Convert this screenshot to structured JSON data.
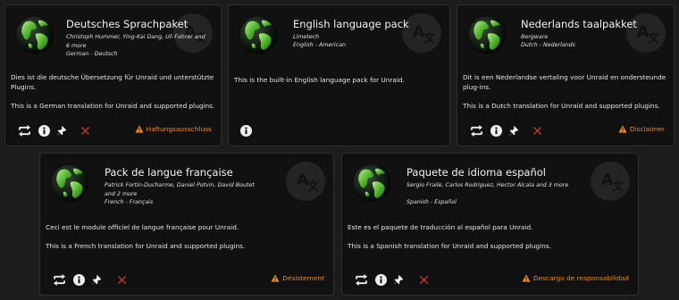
{
  "colors": {
    "accent": "#f08a1c",
    "close": "#c0392b",
    "card_bg": "#111111"
  },
  "icons": {
    "globe": "globe-icon",
    "watermark": "translate-icon",
    "sync": "sync-icon",
    "info": "info-icon",
    "pin": "pin-icon",
    "remove": "close-icon",
    "warning": "warning-icon"
  },
  "plugins": [
    {
      "name": "Deutsches Sprachpaket",
      "authors": "Christoph Hummer, Ying-Kai Dang, Uli Fahrer and 6 more",
      "language": "German - Deutsch",
      "description": "Dies ist die deutsche Übersetzung für Unraid und unterstützte Plugins.",
      "translation_note": "This is a German translation for Unraid and supported plugins.",
      "disclaimer": "Haftungsausschluss"
    },
    {
      "name": "English language pack",
      "authors": "Limetech",
      "language": "English - American",
      "description": "This is the built-in English language pack for Unraid.",
      "translation_note": "",
      "disclaimer": ""
    },
    {
      "name": "Nederlands taalpakket",
      "authors": "Bergware",
      "language": "Dutch - Nederlands",
      "description": "Dit is een Nederlandse vertaling voor Unraid en ondersteunde plug-ins.",
      "translation_note": "This is a Dutch translation for Unraid and supported plugins.",
      "disclaimer": "Disclaimer"
    },
    {
      "name": "Pack de langue française",
      "authors": "Patrick Fortin-Ducharme, Daniel Potvin, David Boutet and 2 more",
      "language": "French - Français",
      "description": "Ceci est le module officiel de langue française pour Unraid.",
      "translation_note": "This is a French translation for Unraid and supported plugins.",
      "disclaimer": "Désistement"
    },
    {
      "name": "Paquete de idioma español",
      "authors": "Sergio Fraile, Carlos Rodriguez, Hector Alcala and 3 more",
      "language": "Spanish - Español",
      "description": "Este es el paquete de traducción al español para Unraid.",
      "translation_note": "This is a Spanish translation for Unraid and supported plugins.",
      "disclaimer": "Descargo de responsabilidad"
    }
  ]
}
